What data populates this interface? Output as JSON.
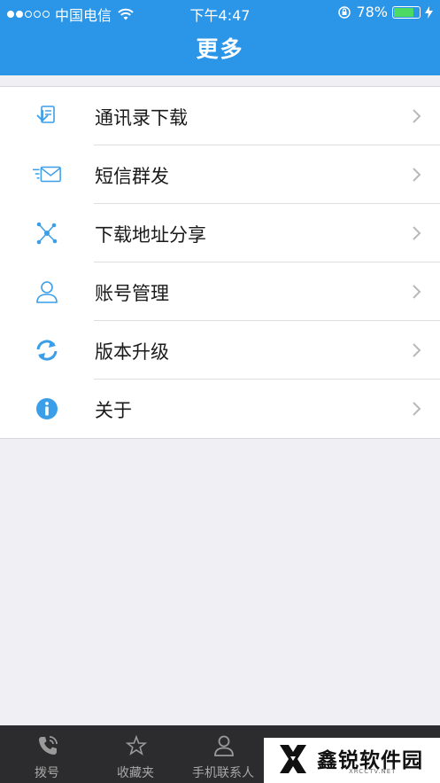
{
  "status_bar": {
    "carrier": "中国电信",
    "time": "下午4:47",
    "battery": "78%",
    "battery_level": 0.78,
    "signal_filled_dots": 2,
    "signal_total_dots": 5
  },
  "header": {
    "title": "更多"
  },
  "menu": {
    "items": [
      {
        "label": "通讯录下载",
        "icon": "contacts-download-icon"
      },
      {
        "label": "短信群发",
        "icon": "sms-broadcast-icon"
      },
      {
        "label": "下载地址分享",
        "icon": "share-icon"
      },
      {
        "label": "账号管理",
        "icon": "user-account-icon"
      },
      {
        "label": "版本升级",
        "icon": "refresh-upgrade-icon"
      },
      {
        "label": "关于",
        "icon": "info-icon"
      }
    ]
  },
  "tab_bar": {
    "tabs": [
      {
        "label": "拨号",
        "icon": "phone-dial-icon"
      },
      {
        "label": "收藏夹",
        "icon": "star-icon"
      },
      {
        "label": "手机联系人",
        "icon": "contact-person-icon"
      }
    ]
  },
  "watermark": {
    "name": "鑫锐软件园",
    "domain": "XRCCTV.NET"
  },
  "colors": {
    "header_bg": "#2b95e8",
    "icon_blue": "#3a9ee8",
    "page_bg": "#efeff4",
    "tab_bar_bg": "#2c2c2e",
    "battery_green": "#4cd964"
  }
}
